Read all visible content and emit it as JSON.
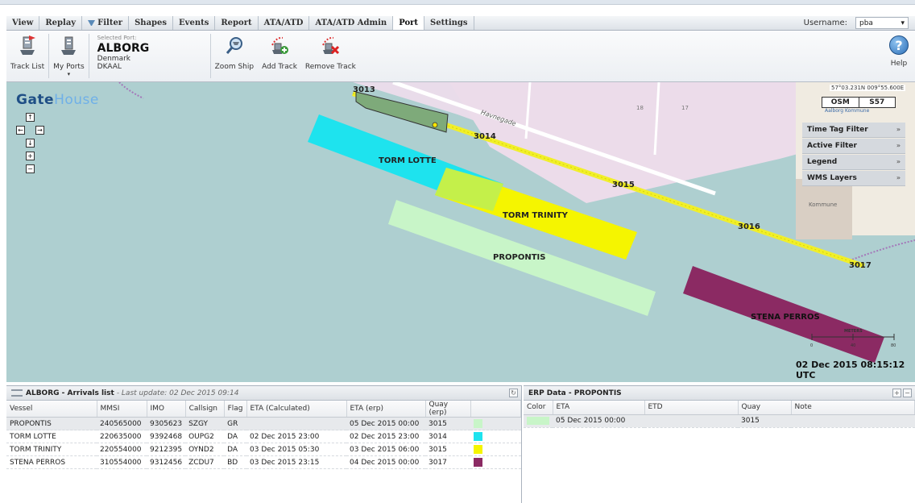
{
  "menu": {
    "tabs": [
      {
        "label": "View"
      },
      {
        "label": "Replay"
      },
      {
        "label": "Filter"
      },
      {
        "label": "Shapes"
      },
      {
        "label": "Events"
      },
      {
        "label": "Report"
      },
      {
        "label": "ATA/ATD"
      },
      {
        "label": "ATA/ATD Admin"
      },
      {
        "label": "Port"
      },
      {
        "label": "Settings"
      }
    ],
    "active": "Port",
    "username_label": "Username:",
    "username_value": "pba"
  },
  "toolbar": {
    "track_list": "Track List",
    "my_ports": "My Ports",
    "selected_caption": "Selected Port:",
    "port_name": "ALBORG",
    "port_country": "Denmark",
    "port_code": "DKAAL",
    "zoom_ship": "Zoom Ship",
    "add_track": "Add Track",
    "remove_track": "Remove Track",
    "help": "Help"
  },
  "map": {
    "logo_part1": "Gate",
    "logo_part2": "House",
    "street": "Havnegade",
    "quays": [
      "3013",
      "3014",
      "3015",
      "3016",
      "3017"
    ],
    "blocks": [
      "18",
      "17"
    ],
    "vessel_labels": [
      "TORM LOTTE",
      "TORM TRINITY",
      "PROPONTIS",
      "STENA PERROS"
    ],
    "coords": "57°03.231N 009°55.600E",
    "osm": "OSM",
    "osm_value": "S57",
    "kommune_small": "Aalborg Kommune",
    "kommune": "Kommune",
    "panels": [
      "Time Tag Filter",
      "Active Filter",
      "Legend",
      "WMS Layers"
    ],
    "scale_title": "METERS",
    "scale_ticks": [
      "0",
      "40",
      "80"
    ],
    "timestamp": "02 Dec 2015 08:15:12 UTC"
  },
  "arrivals": {
    "title": "ALBORG - Arrivals list",
    "subtitle": "- Last update: 02 Dec 2015 09:14",
    "columns": [
      "Vessel",
      "MMSI",
      "IMO",
      "Callsign",
      "Flag",
      "ETA (Calculated)",
      "ETA (erp)",
      "Quay (erp)",
      ""
    ],
    "rows": [
      {
        "vessel": "PROPONTIS",
        "mmsi": "240565000",
        "imo": "9305623",
        "callsign": "SZGY",
        "flag": "GR",
        "eta_calc": "",
        "eta_erp": "05 Dec 2015 00:00",
        "quay": "3015",
        "color": "#c8f5c8"
      },
      {
        "vessel": "TORM LOTTE",
        "mmsi": "220635000",
        "imo": "9392468",
        "callsign": "OUPG2",
        "flag": "DA",
        "eta_calc": "02 Dec 2015 23:00",
        "eta_erp": "02 Dec 2015 23:00",
        "quay": "3014",
        "color": "#1ee3ee"
      },
      {
        "vessel": "TORM TRINITY",
        "mmsi": "220554000",
        "imo": "9212395",
        "callsign": "OYND2",
        "flag": "DA",
        "eta_calc": "03 Dec 2015 05:30",
        "eta_erp": "03 Dec 2015 06:00",
        "quay": "3015",
        "color": "#f5f500"
      },
      {
        "vessel": "STENA PERROS",
        "mmsi": "310554000",
        "imo": "9312456",
        "callsign": "ZCDU7",
        "flag": "BD",
        "eta_calc": "03 Dec 2015 23:15",
        "eta_erp": "04 Dec 2015 00:00",
        "quay": "3017",
        "color": "#8b2a63"
      }
    ]
  },
  "erp": {
    "title": "ERP Data - PROPONTIS",
    "columns": [
      "Color",
      "ETA",
      "ETD",
      "Quay",
      "Note"
    ],
    "rows": [
      {
        "color": "#c8f5c8",
        "eta": "05 Dec 2015 00:00",
        "etd": "",
        "quay": "3015",
        "note": ""
      }
    ]
  }
}
